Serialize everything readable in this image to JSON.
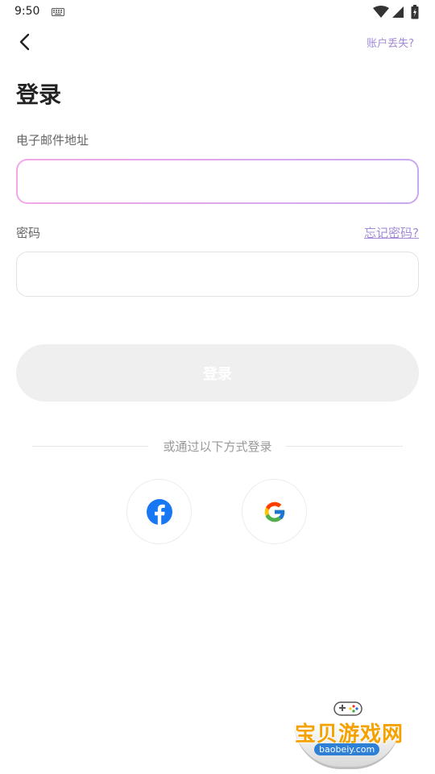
{
  "status_bar": {
    "time": "9:50",
    "icons": [
      "keyboard-icon",
      "wifi-icon",
      "signal-icon",
      "battery-icon"
    ]
  },
  "header": {
    "back_icon": "chevron-left-icon",
    "lost_account": "账户丢失?"
  },
  "title": "登录",
  "email": {
    "label": "电子邮件地址",
    "value": "",
    "placeholder": ""
  },
  "password": {
    "label": "密码",
    "forgot": "忘记密码? ",
    "value": "",
    "placeholder": ""
  },
  "login_button": {
    "label": "登录"
  },
  "alt_login": {
    "text": "或通过以下方式登录",
    "providers": [
      "facebook-icon",
      "google-icon"
    ]
  },
  "watermark": {
    "text": "宝贝游戏网",
    "url": "baobeiy.com"
  },
  "colors": {
    "accent": "#a38bd8",
    "facebook": "#1877f2",
    "button_disabled": "#efefef",
    "watermark": "#f5a200"
  }
}
